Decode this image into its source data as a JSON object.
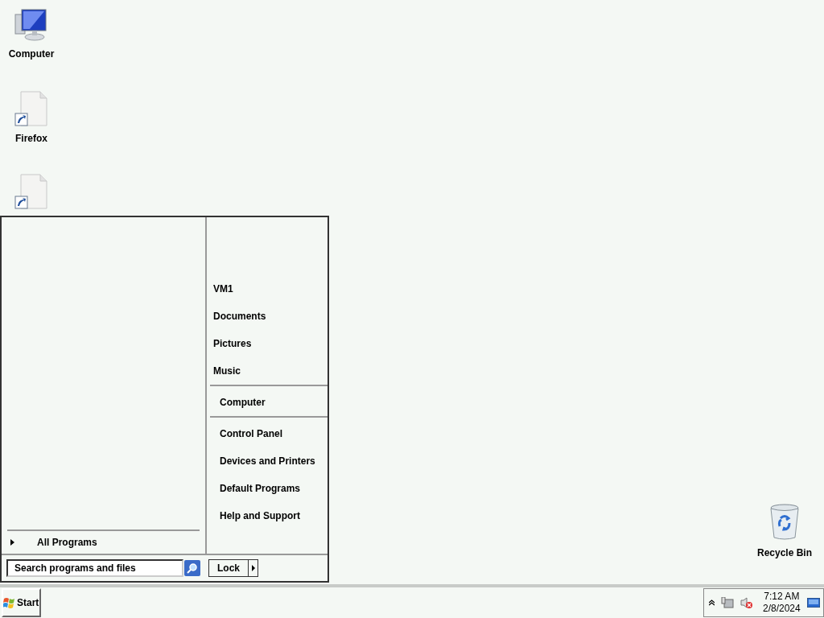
{
  "desktop_icons": [
    {
      "kind": "computer",
      "label": "Computer"
    },
    {
      "kind": "shortcut",
      "label": "Firefox"
    },
    {
      "kind": "shortcut"
    }
  ],
  "recycle_bin": {
    "label": "Recycle Bin"
  },
  "start_menu": {
    "all_programs": "All Programs",
    "search": {
      "placeholder": "Search programs and files"
    },
    "lock_button": "Lock",
    "right_groups": [
      [
        "VM1",
        "Documents",
        "Pictures",
        "Music"
      ],
      [
        "Computer"
      ],
      [
        "Control Panel",
        "Devices and Printers",
        "Default Programs",
        "Help and Support"
      ]
    ]
  },
  "taskbar": {
    "start": "Start",
    "time": "7:12 AM",
    "date": "2/8/2024"
  }
}
